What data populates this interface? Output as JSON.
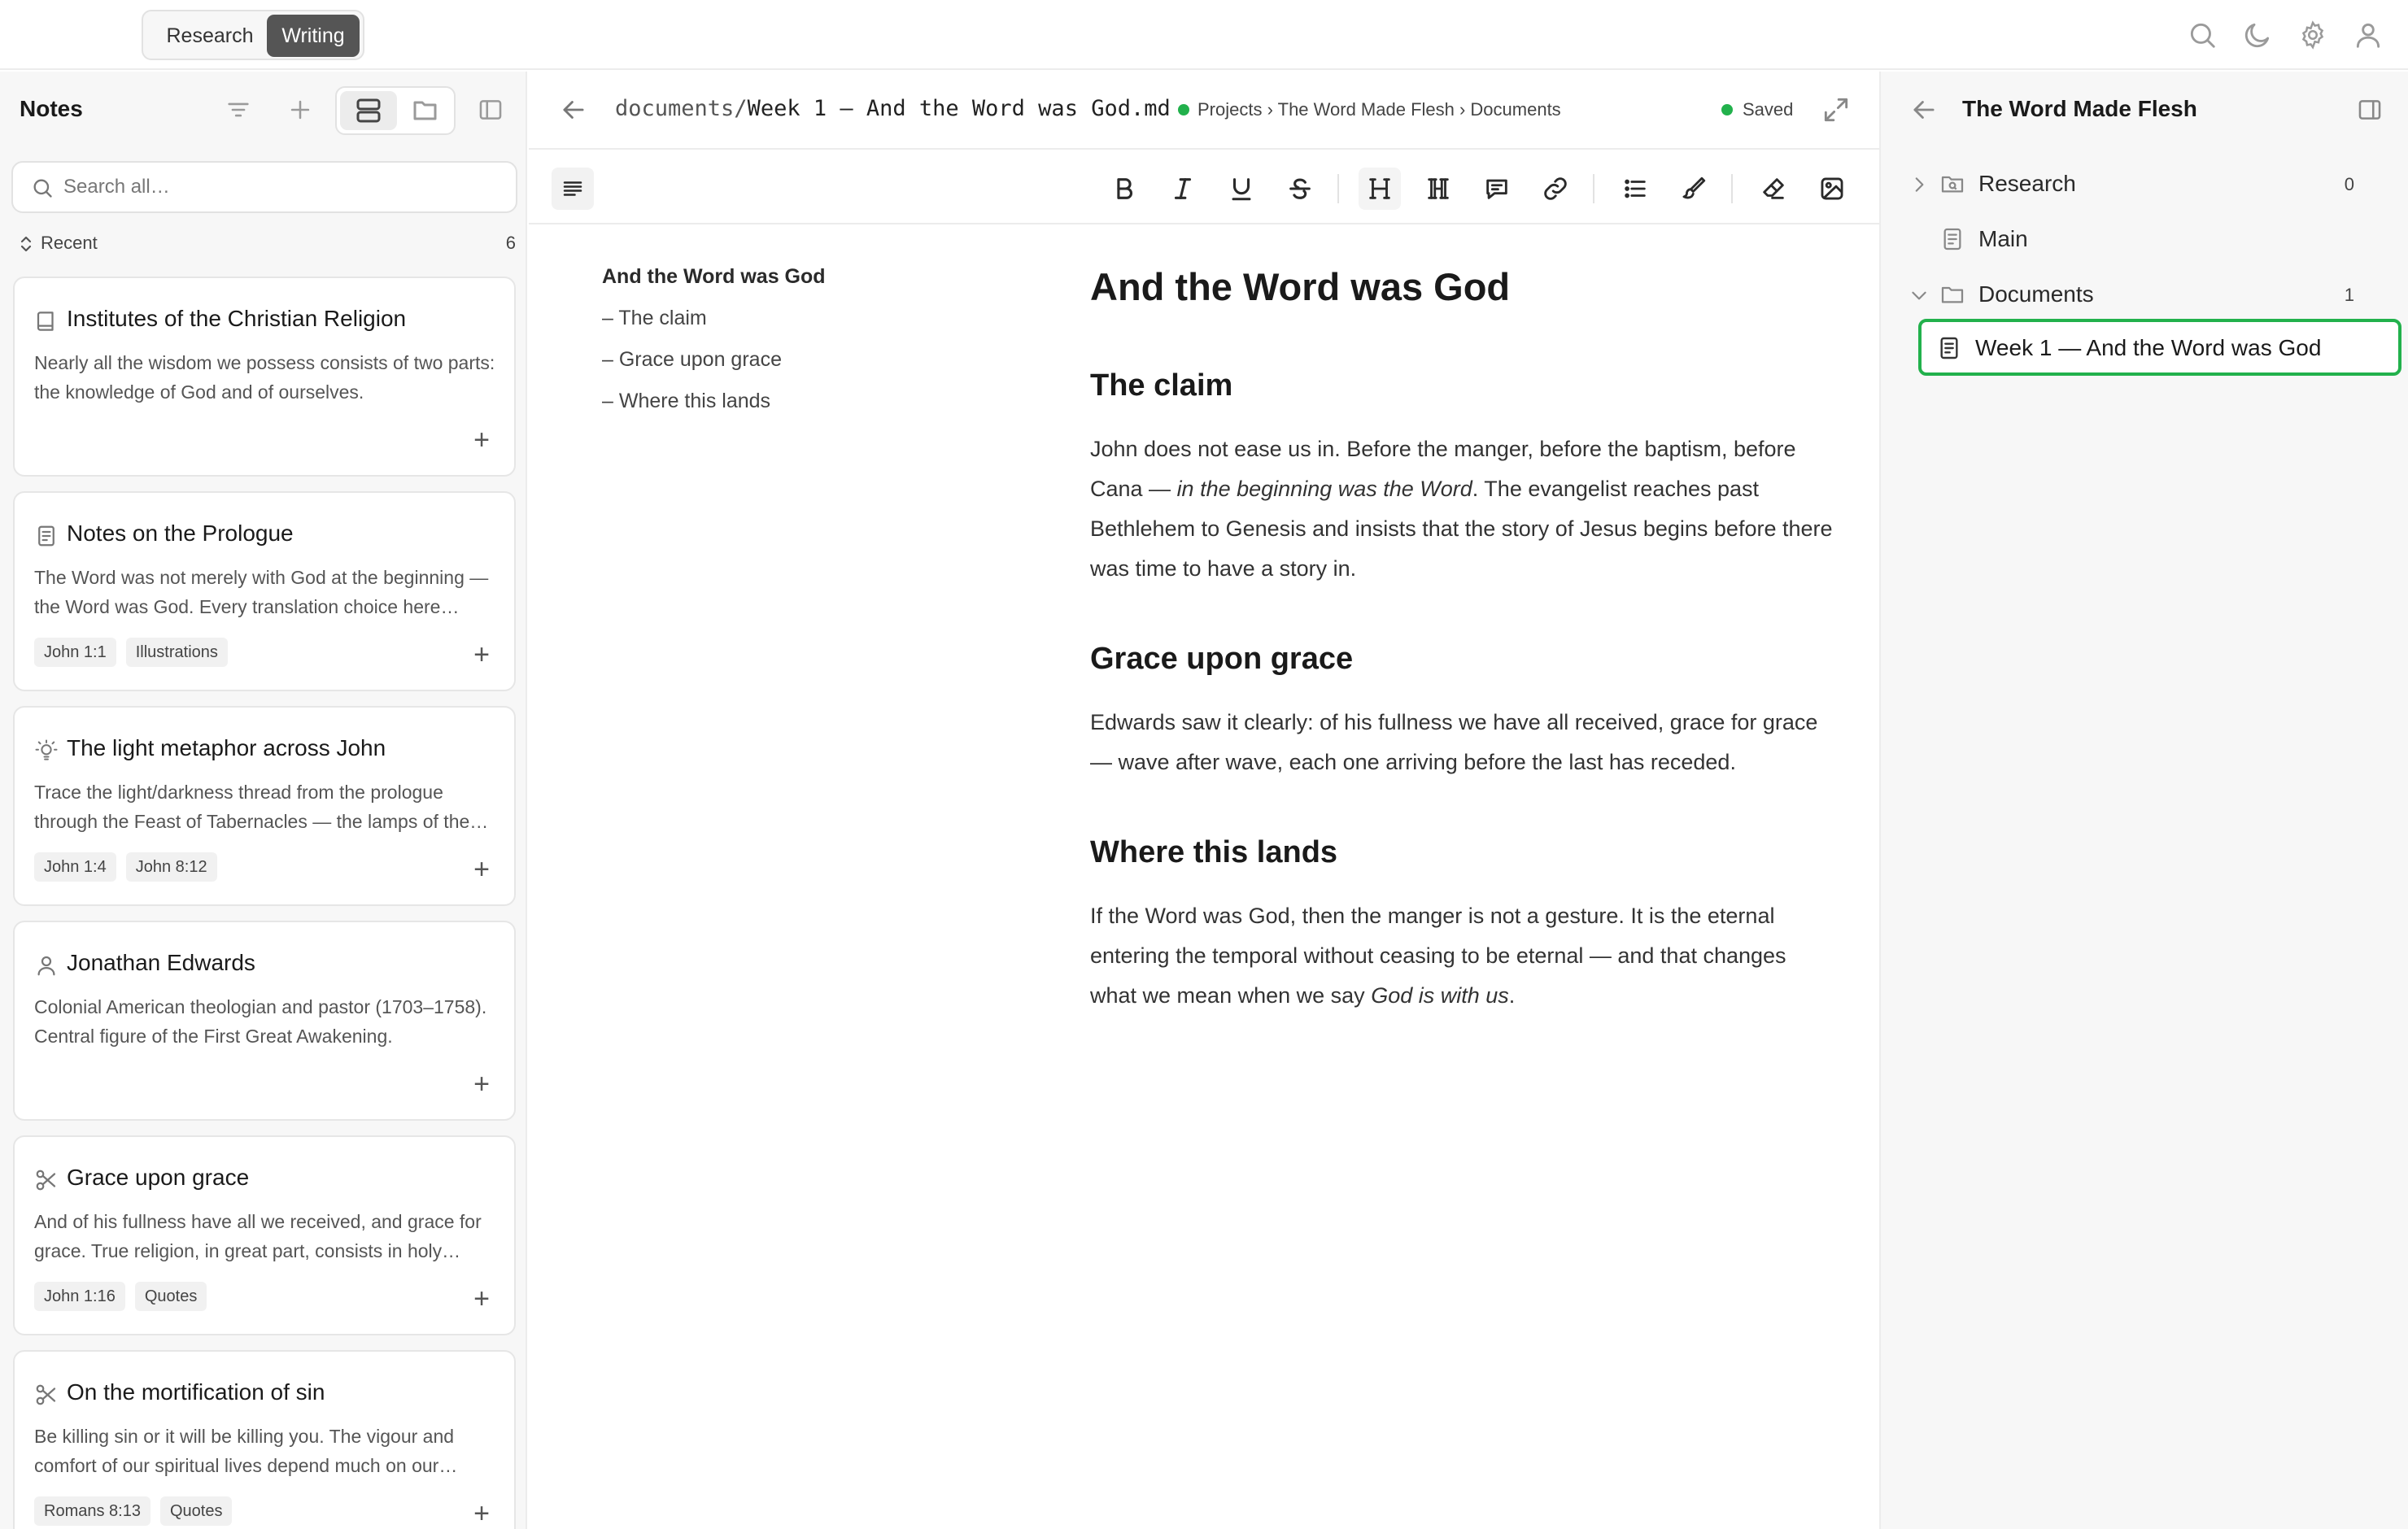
{
  "topbar": {
    "modes": [
      "Research",
      "Writing"
    ],
    "active_mode": "Writing",
    "icons": [
      "search-icon",
      "moon-icon",
      "gear-icon",
      "user-icon"
    ]
  },
  "notes_panel": {
    "title": "Notes",
    "search_placeholder": "Search all…",
    "recent_label": "Recent",
    "recent_count": "6",
    "cards": [
      {
        "icon": "book-icon",
        "title": "Institutes of the Christian Religion",
        "body": "Nearly all the wisdom we possess consists of two parts: the knowledge of God and of ourselves.",
        "tags": []
      },
      {
        "icon": "document-icon",
        "title": "Notes on the Prologue",
        "body": "The Word was not merely with God at the beginning — the Word was God. Every translation choice here matters.",
        "tags": [
          "John 1:1",
          "Illustrations"
        ]
      },
      {
        "icon": "lightbulb-icon",
        "title": "The light metaphor across John",
        "body": "Trace the light/darkness thread from the prologue through the Feast of Tabernacles — the lamps of the temple.",
        "tags": [
          "John 1:4",
          "John 8:12"
        ]
      },
      {
        "icon": "person-icon",
        "title": "Jonathan Edwards",
        "body": "Colonial American theologian and pastor (1703–1758). Central figure of the First Great Awakening.",
        "tags": []
      },
      {
        "icon": "scissors-icon",
        "title": "Grace upon grace",
        "body": "And of his fullness have all we received, and grace for grace. True religion, in great part, consists in holy affections.",
        "tags": [
          "John 1:16",
          "Quotes"
        ]
      },
      {
        "icon": "scissors-icon",
        "title": "On the mortification of sin",
        "body": "Be killing sin or it will be killing you. The vigour and comfort of our spiritual lives depend much on our mortification of sin.",
        "tags": [
          "Romans 8:13",
          "Quotes"
        ]
      }
    ]
  },
  "editor": {
    "path_prefix": "documents/",
    "path_file": "Week 1 — And the Word was God.md",
    "breadcrumb": "Projects › The Word Made Flesh › Documents",
    "status": "Saved",
    "outline": {
      "title": "And the Word was God",
      "items": [
        "– The claim",
        "– Grace upon grace",
        "– Where this lands"
      ]
    },
    "document": {
      "title": "And the Word was God",
      "s1_heading": "The claim",
      "s1_p_a": "John does not ease us in. Before the manger, before the baptism, before Cana — ",
      "s1_p_em": "in the beginning was the Word",
      "s1_p_b": ". The evangelist reaches past Bethlehem to Genesis and insists that the story of Jesus begins before there was time to have a story in.",
      "s2_heading": "Grace upon grace",
      "s2_p": "Edwards saw it clearly: of his fullness we have all received, grace for grace — wave after wave, each one arriving before the last has receded.",
      "s3_heading": "Where this lands",
      "s3_p_a": "If the Word was God, then the manger is not a gesture. It is the eternal entering the temporal without ceasing to be eternal — and that changes what we mean when we say ",
      "s3_p_em": "God is with us",
      "s3_p_b": "."
    }
  },
  "project_panel": {
    "title": "The Word Made Flesh",
    "tree": [
      {
        "label": "Research",
        "count": "0"
      },
      {
        "label": "Main"
      },
      {
        "label": "Documents",
        "count": "1"
      },
      {
        "label": "Week 1 — And the Word was God"
      }
    ]
  },
  "colors": {
    "accent_green": "#22b14c",
    "active_mode_bg": "#555555"
  }
}
